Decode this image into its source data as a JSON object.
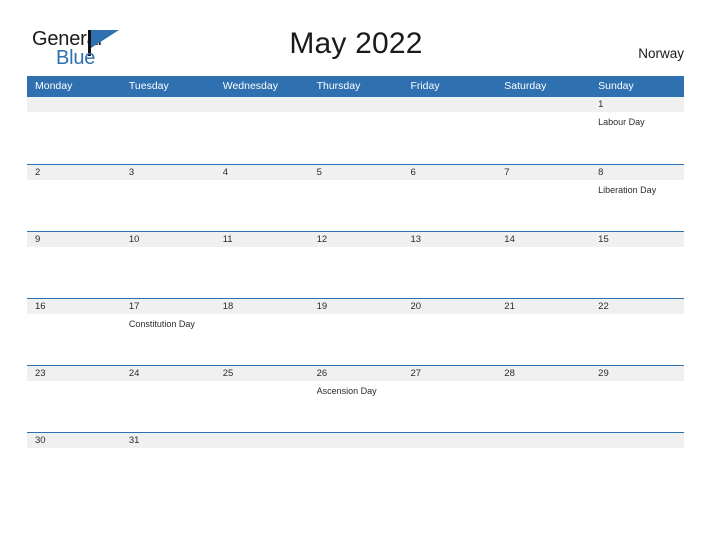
{
  "brand": {
    "name_primary": "General",
    "name_secondary": "Blue",
    "accent_color": "#2E70B0",
    "flag_icon": "flag-icon"
  },
  "header": {
    "title": "May 2022",
    "region": "Norway"
  },
  "calendar": {
    "weekdays": [
      "Monday",
      "Tuesday",
      "Wednesday",
      "Thursday",
      "Friday",
      "Saturday",
      "Sunday"
    ],
    "weeks": [
      [
        {
          "date": "",
          "events": []
        },
        {
          "date": "",
          "events": []
        },
        {
          "date": "",
          "events": []
        },
        {
          "date": "",
          "events": []
        },
        {
          "date": "",
          "events": []
        },
        {
          "date": "",
          "events": []
        },
        {
          "date": "1",
          "events": [
            "Labour Day"
          ]
        }
      ],
      [
        {
          "date": "2",
          "events": []
        },
        {
          "date": "3",
          "events": []
        },
        {
          "date": "4",
          "events": []
        },
        {
          "date": "5",
          "events": []
        },
        {
          "date": "6",
          "events": []
        },
        {
          "date": "7",
          "events": []
        },
        {
          "date": "8",
          "events": [
            "Liberation Day"
          ]
        }
      ],
      [
        {
          "date": "9",
          "events": []
        },
        {
          "date": "10",
          "events": []
        },
        {
          "date": "11",
          "events": []
        },
        {
          "date": "12",
          "events": []
        },
        {
          "date": "13",
          "events": []
        },
        {
          "date": "14",
          "events": []
        },
        {
          "date": "15",
          "events": []
        }
      ],
      [
        {
          "date": "16",
          "events": []
        },
        {
          "date": "17",
          "events": [
            "Constitution Day"
          ]
        },
        {
          "date": "18",
          "events": []
        },
        {
          "date": "19",
          "events": []
        },
        {
          "date": "20",
          "events": []
        },
        {
          "date": "21",
          "events": []
        },
        {
          "date": "22",
          "events": []
        }
      ],
      [
        {
          "date": "23",
          "events": []
        },
        {
          "date": "24",
          "events": []
        },
        {
          "date": "25",
          "events": []
        },
        {
          "date": "26",
          "events": [
            "Ascension Day"
          ]
        },
        {
          "date": "27",
          "events": []
        },
        {
          "date": "28",
          "events": []
        },
        {
          "date": "29",
          "events": []
        }
      ],
      [
        {
          "date": "30",
          "events": []
        },
        {
          "date": "31",
          "events": []
        },
        {
          "date": "",
          "events": []
        },
        {
          "date": "",
          "events": []
        },
        {
          "date": "",
          "events": []
        },
        {
          "date": "",
          "events": []
        },
        {
          "date": "",
          "events": []
        }
      ]
    ]
  }
}
